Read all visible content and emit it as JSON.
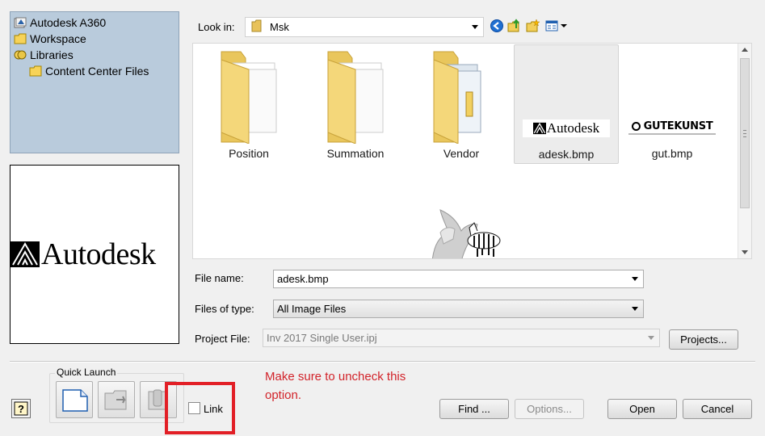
{
  "tree": {
    "items": [
      {
        "label": "Autodesk A360",
        "icon": "a360-icon"
      },
      {
        "label": "Workspace",
        "icon": "folder-icon"
      },
      {
        "label": "Libraries",
        "icon": "library-icon"
      },
      {
        "label": "Content Center Files",
        "icon": "folder-icon"
      }
    ]
  },
  "preview": {
    "logo_text": "Autodesk"
  },
  "lookin": {
    "label": "Look in:",
    "value": "Msk"
  },
  "toolbar": {
    "icons": [
      "back-icon",
      "up-folder-icon",
      "new-folder-icon",
      "view-menu-icon"
    ]
  },
  "files": [
    {
      "name": "Position",
      "type": "folder"
    },
    {
      "name": "Summation",
      "type": "folder"
    },
    {
      "name": "Vendor",
      "type": "folder"
    },
    {
      "name": "adesk.bmp",
      "type": "image",
      "thumb_text": "Autodesk",
      "selected": true
    },
    {
      "name": "gut.bmp",
      "type": "image",
      "thumb_text": "GUTEKUNST"
    },
    {
      "name": "",
      "type": "image"
    }
  ],
  "file_name": {
    "label": "File name:",
    "value": "adesk.bmp"
  },
  "files_of_type": {
    "label": "Files of type:",
    "value": "All Image Files"
  },
  "project_file": {
    "label": "Project File:",
    "value": "Inv 2017 Single User.ipj",
    "button": "Projects..."
  },
  "quick_launch": {
    "label": "Quick Launch"
  },
  "link": {
    "label": "Link",
    "checked": false
  },
  "annotation": {
    "text": "Make sure to uncheck this option.",
    "color": "#d2232a"
  },
  "buttons": {
    "find": "Find ...",
    "options": "Options...",
    "open": "Open",
    "cancel": "Cancel"
  },
  "colors": {
    "tree_bg": "#b9cbdc",
    "highlight": "#e21f26"
  }
}
